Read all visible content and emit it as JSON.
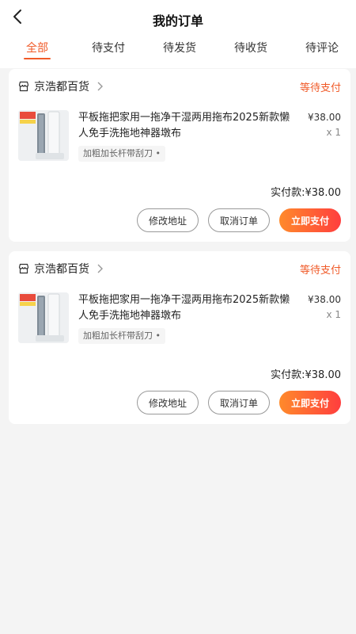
{
  "header": {
    "title": "我的订单",
    "back_icon": "chevron-left-icon"
  },
  "tabs": [
    {
      "label": "全部",
      "active": true
    },
    {
      "label": "待支付",
      "active": false
    },
    {
      "label": "待发货",
      "active": false
    },
    {
      "label": "待收货",
      "active": false
    },
    {
      "label": "待评论",
      "active": false
    }
  ],
  "colors": {
    "accent": "#f05a28",
    "pay_gradient_start": "#ff8a2b",
    "pay_gradient_end": "#ff3e3e"
  },
  "orders": [
    {
      "shop_name": "京浩都百货",
      "status": "等待支付",
      "product_title": "平板拖把家用一拖净干湿两用拖布2025新款懒人免手洗拖地神器墩布",
      "sku": "加粗加长杆带刮刀",
      "price": "¥38.00",
      "qty": "x 1",
      "total_label": "实付款:",
      "total_value": "¥38.00",
      "buttons": {
        "edit_address": "修改地址",
        "cancel_order": "取消订单",
        "pay_now": "立即支付"
      }
    },
    {
      "shop_name": "京浩都百货",
      "status": "等待支付",
      "product_title": "平板拖把家用一拖净干湿两用拖布2025新款懒人免手洗拖地神器墩布",
      "sku": "加粗加长杆带刮刀",
      "price": "¥38.00",
      "qty": "x 1",
      "total_label": "实付款:",
      "total_value": "¥38.00",
      "buttons": {
        "edit_address": "修改地址",
        "cancel_order": "取消订单",
        "pay_now": "立即支付"
      }
    }
  ]
}
